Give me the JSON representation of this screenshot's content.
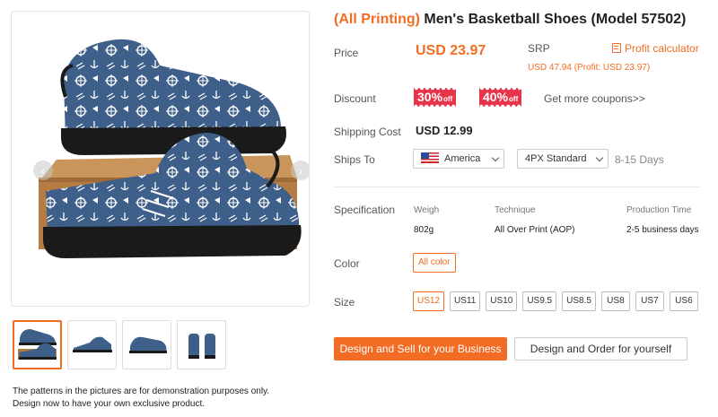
{
  "note": {
    "line1": "The patterns in the pictures are for demonstration purposes only.",
    "line2": "Design now to have your own exclusive product."
  },
  "product": {
    "title_highlight": "(All Printing)",
    "title_rest": " Men's Basketball Shoes (Model 57502)"
  },
  "price": {
    "label": "Price",
    "value": "USD 23.97",
    "srp_label": "SRP",
    "srp_detail": "USD 47.94 (Profit: USD 23.97)",
    "profit_calculator": "Profit calculator"
  },
  "discount": {
    "label": "Discount",
    "coupons": [
      {
        "value": "30%",
        "suffix": "off"
      },
      {
        "value": "40%",
        "suffix": "off"
      }
    ],
    "more": "Get more coupons>>"
  },
  "shipping": {
    "cost_label": "Shipping Cost",
    "cost": "USD 12.99",
    "ships_to_label": "Ships To",
    "country": "America",
    "method": "4PX Standard",
    "days": "8-15 Days"
  },
  "specification": {
    "label": "Specification",
    "headers": [
      "Weigh",
      "Technique",
      "Production Time"
    ],
    "values": [
      "802g",
      "All Over Print (AOP)",
      "2-5 business days"
    ]
  },
  "color": {
    "label": "Color",
    "selected": "All color"
  },
  "size": {
    "label": "Size",
    "options": [
      "US12",
      "US11",
      "US10",
      "US9.5",
      "US8.5",
      "US8",
      "US7",
      "US6"
    ],
    "selected_index": 0
  },
  "actions": {
    "primary": "Design and Sell for your Business",
    "secondary": "Design and Order for yourself"
  },
  "colors": {
    "accent": "#f26c23",
    "coupon": "#e8344b",
    "shoe": "#3e5f8a"
  }
}
